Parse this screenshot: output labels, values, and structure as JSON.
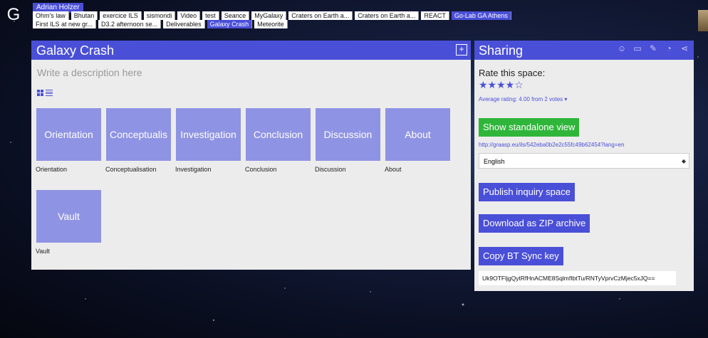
{
  "app": {
    "logo_glyph": "G",
    "user_name": "Adrian Holzer"
  },
  "tabs_row1": [
    "Ohm's law",
    "Bhutan",
    "exercice ILS",
    "sismondi",
    "Video",
    "test",
    "Seance",
    "MyGalaxy",
    "Craters on Earth a...",
    "Craters on Earth a...",
    "REACT",
    "Go-Lab GA Athens"
  ],
  "tabs_row2": [
    "First ILS at new gr...",
    "D3.2 afternoon se...",
    "Deliverables",
    "Galaxy Crash",
    "Meteorite"
  ],
  "active_tab": "Galaxy Crash",
  "active_tab_row1": "Go-Lab GA Athens",
  "main": {
    "title": "Galaxy Crash",
    "add_button": "+",
    "description_placeholder": "Write a description here",
    "phases": [
      {
        "tile": "Orientation",
        "caption": "Orientation"
      },
      {
        "tile": "Conceptualis",
        "caption": "Conceptualisation"
      },
      {
        "tile": "Investigation",
        "caption": "Investigation"
      },
      {
        "tile": "Conclusion",
        "caption": "Conclusion"
      },
      {
        "tile": "Discussion",
        "caption": "Discussion"
      },
      {
        "tile": "About",
        "caption": "About"
      },
      {
        "tile": "Vault",
        "caption": "Vault"
      }
    ]
  },
  "sharing": {
    "title": "Sharing",
    "rate_label": "Rate this space:",
    "stars": "★★★★☆",
    "rating": 4,
    "avg_text": "Average rating: 4.00 from 2 votes ▾",
    "standalone_button": "Show standalone view",
    "standalone_link": "http://graasp.eu/ils/542eba0b2e2c55fc49b62454?lang=en",
    "language_selected": "English",
    "publish_button": "Publish inquiry space",
    "zip_button": "Download as ZIP archive",
    "btsync_button": "Copy BT Sync key",
    "btsync_key": "Uk9OTFljgQytRfHnACME8SqlmfIbtTu/RNTyVprvCzMjec5xJQ=="
  },
  "colors": {
    "accent": "#4a4fd8",
    "tile": "#8f93e3",
    "green": "#2fb63a",
    "panel": "#ececec"
  }
}
